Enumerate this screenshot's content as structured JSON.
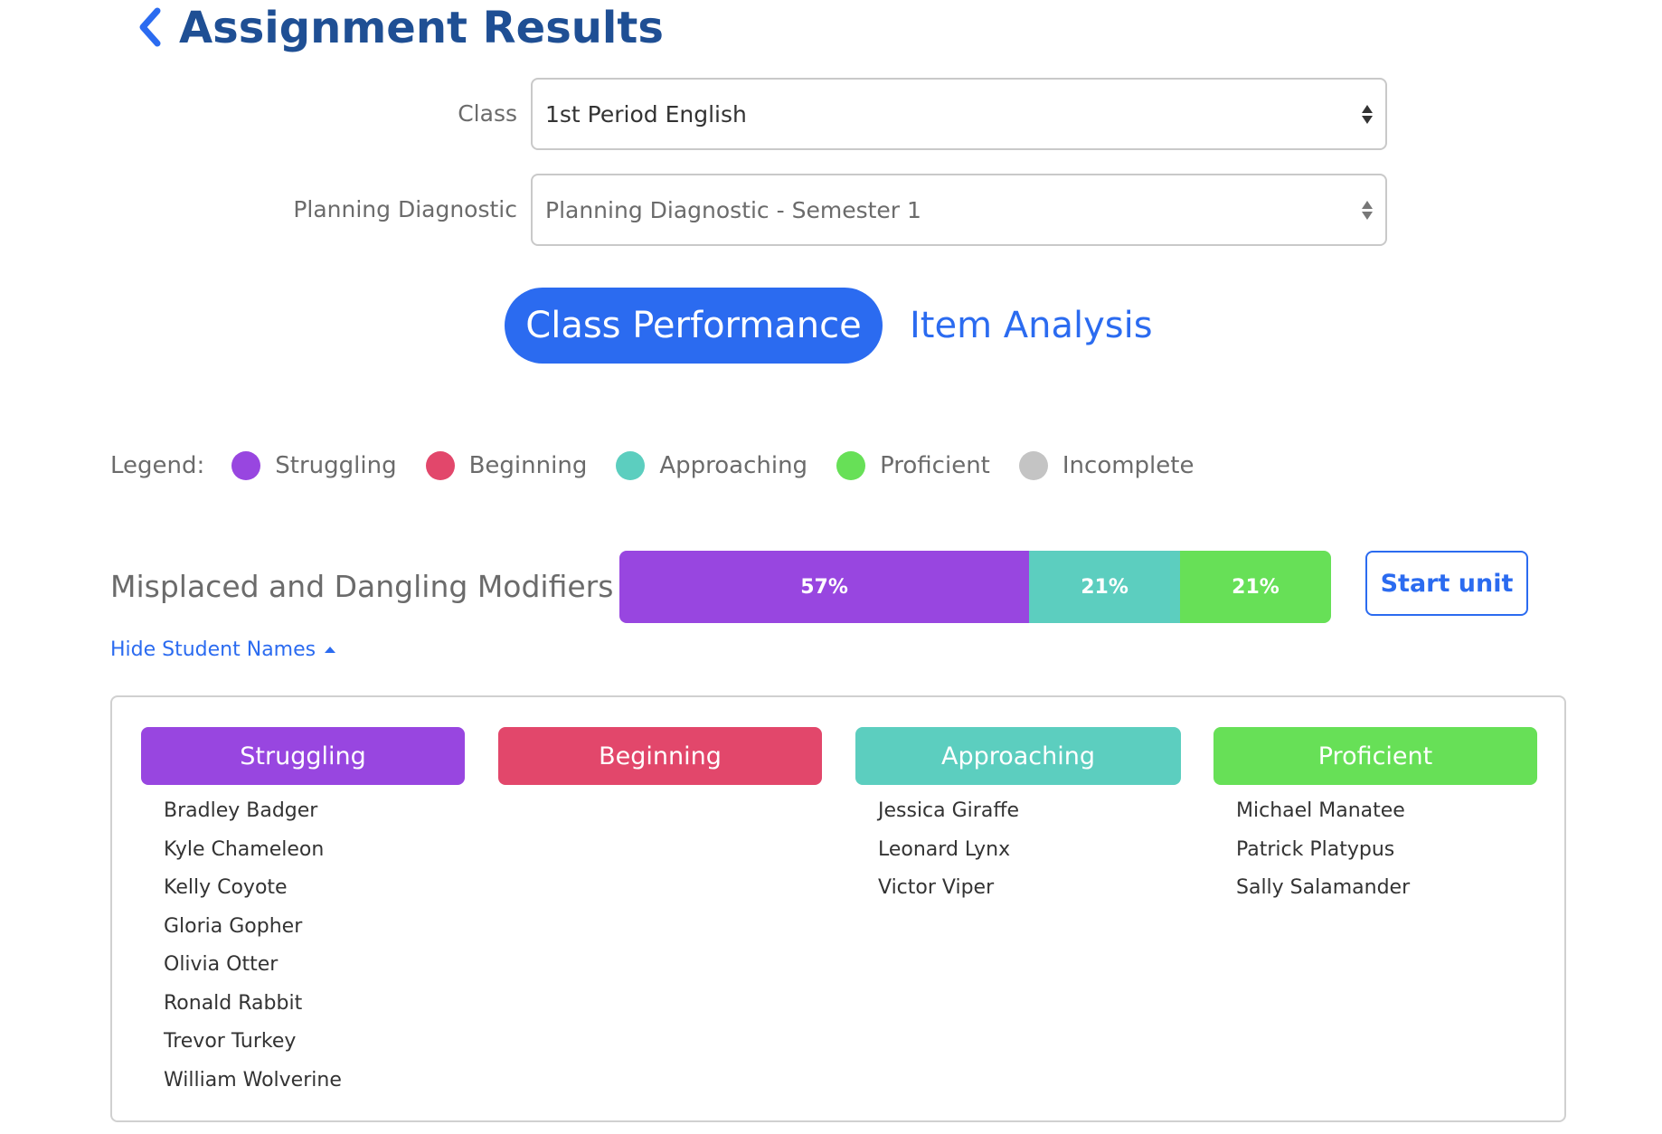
{
  "header": {
    "title": "Assignment Results",
    "back_icon": "chevron-left-icon"
  },
  "form": {
    "class_label": "Class",
    "class_value": "1st Period English",
    "diagnostic_label": "Planning Diagnostic",
    "diagnostic_value": "Planning Diagnostic - Semester 1"
  },
  "tabs": {
    "active": "Class Performance",
    "inactive": "Item Analysis"
  },
  "colors": {
    "struggling": "#9846e0",
    "beginning": "#e2476b",
    "approaching": "#5ccebf",
    "proficient": "#67e057",
    "incomplete": "#c4c4c4",
    "accent": "#2b6bf0",
    "title": "#1f4f94"
  },
  "legend": {
    "title": "Legend:",
    "items": [
      "Struggling",
      "Beginning",
      "Approaching",
      "Proficient",
      "Incomplete"
    ]
  },
  "unit": {
    "name": "Misplaced and Dangling Modifiers",
    "bar_segments": [
      {
        "category": "Struggling",
        "percent": 57,
        "label": "57%"
      },
      {
        "category": "Approaching",
        "percent": 21,
        "label": "21%"
      },
      {
        "category": "Proficient",
        "percent": 21,
        "label": "21%"
      }
    ],
    "start_button": "Start unit",
    "hide_names_link": "Hide Student Names"
  },
  "groups": [
    {
      "title": "Struggling",
      "students": [
        "Bradley Badger",
        "Kyle Chameleon",
        "Kelly Coyote",
        "Gloria Gopher",
        "Olivia Otter",
        "Ronald Rabbit",
        "Trevor Turkey",
        "William Wolverine"
      ]
    },
    {
      "title": "Beginning",
      "students": []
    },
    {
      "title": "Approaching",
      "students": [
        "Jessica Giraffe",
        "Leonard Lynx",
        "Victor Viper"
      ]
    },
    {
      "title": "Proficient",
      "students": [
        "Michael Manatee",
        "Patrick Platypus",
        "Sally Salamander"
      ]
    }
  ]
}
